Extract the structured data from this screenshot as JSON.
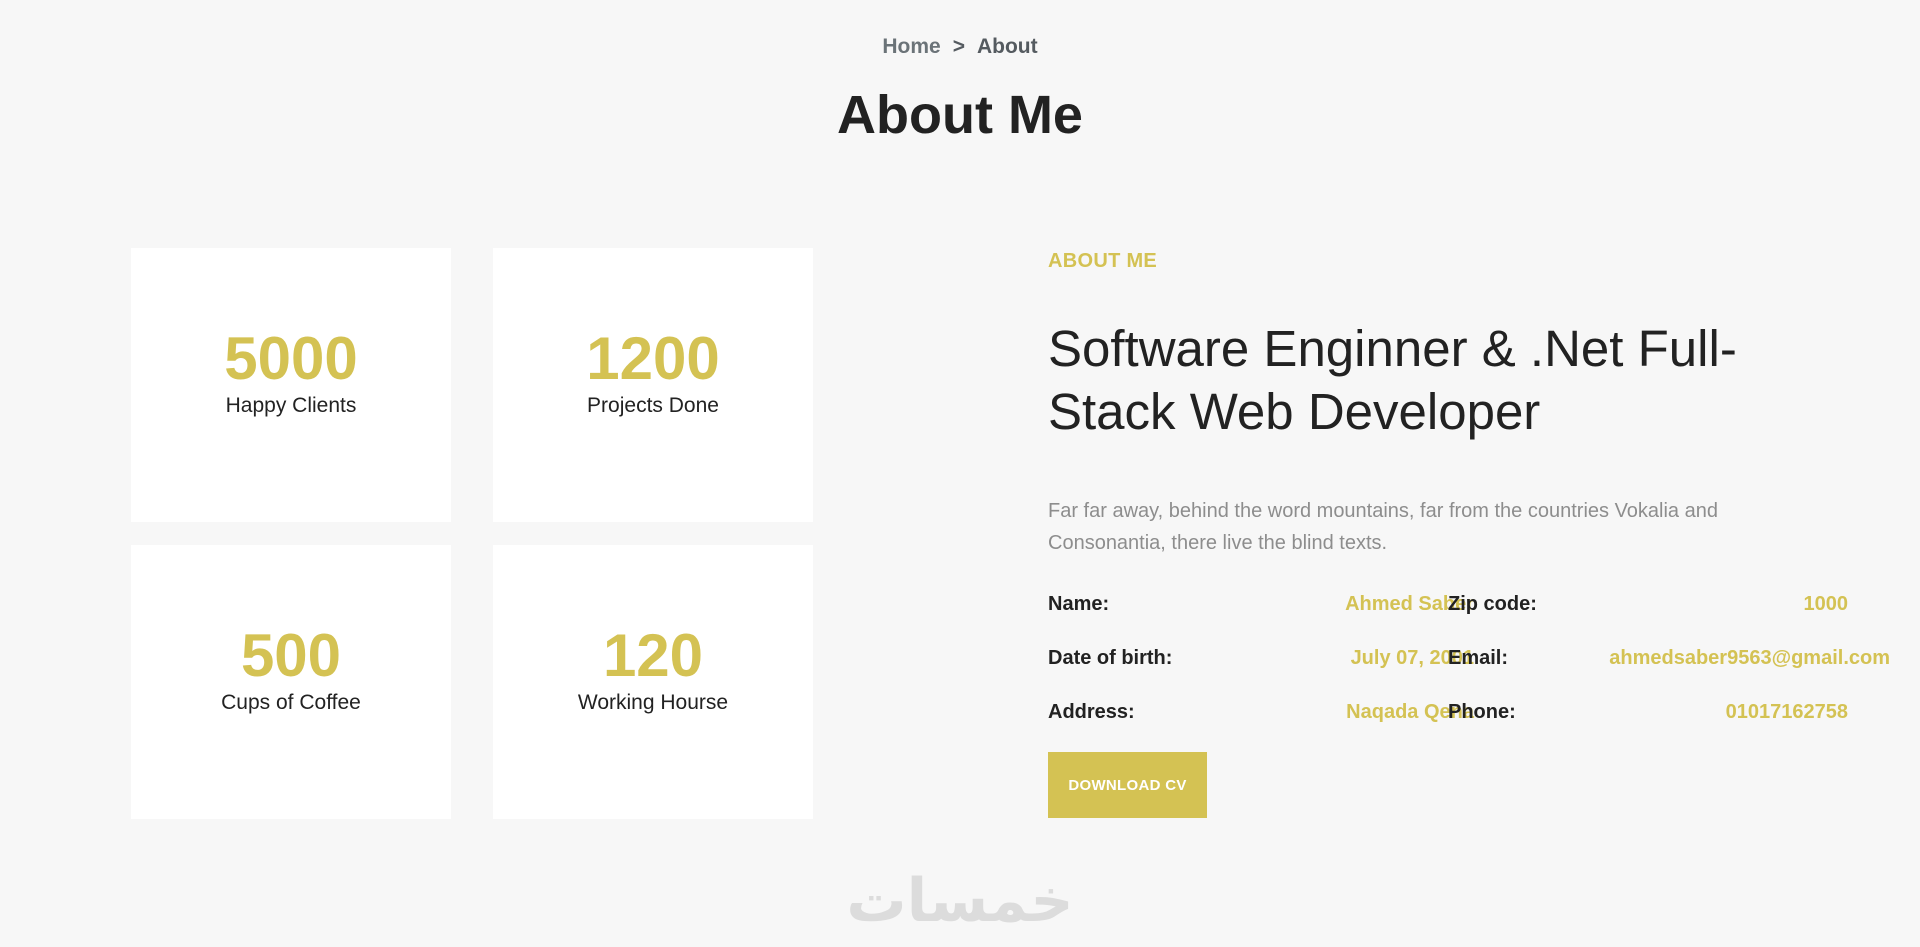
{
  "breadcrumb": {
    "home": "Home",
    "separator": ">",
    "current": "About"
  },
  "page_title": "About Me",
  "stats": [
    {
      "value": "5000",
      "label": "Happy Clients"
    },
    {
      "value": "1200",
      "label": "Projects Done"
    },
    {
      "value": "500",
      "label": "Cups of Coffee"
    },
    {
      "value": "120",
      "label": "Working Hourse"
    }
  ],
  "about": {
    "eyebrow": "ABOUT ME",
    "headline": "Software Enginner & .Net Full-Stack Web Developer",
    "description": "Far far away, behind the word mountains, far from the countries Vokalia and Consonantia, there live the blind texts.",
    "info": [
      {
        "k1": "Name:",
        "v1": "Ahmed Saber",
        "k2": "Zip code:",
        "v2": "1000"
      },
      {
        "k1": "Date of birth:",
        "v1": "July 07, 2001",
        "k2": "Email:",
        "v2": "ahmedsaber9563@gmail.com"
      },
      {
        "k1": "Address:",
        "v1": "Naqada Qena",
        "k2": "Phone:",
        "v2": "01017162758"
      }
    ],
    "download_label": "DOWNLOAD CV"
  },
  "watermark": "خمسات",
  "colors": {
    "accent": "#d4c253",
    "background": "#f7f7f7",
    "card": "#ffffff",
    "text": "#222222",
    "muted": "#8d8d8d"
  }
}
